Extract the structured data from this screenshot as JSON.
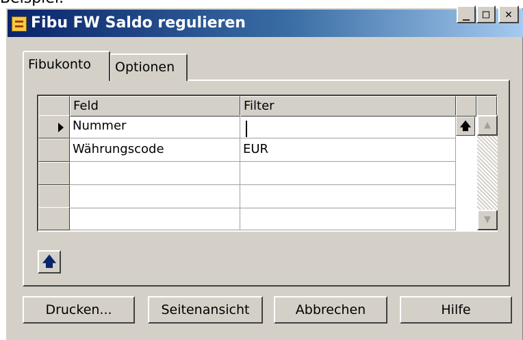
{
  "page_label": "Beispiel:",
  "window": {
    "title": "Fibu FW Saldo regulieren",
    "icon": "app-form-icon",
    "controls": {
      "minimize": "_",
      "maximize": "□",
      "close": "✕"
    }
  },
  "tabs": [
    {
      "label": "Fibukonto",
      "active": true
    },
    {
      "label": "Optionen",
      "active": false
    }
  ],
  "grid": {
    "columns": [
      "Feld",
      "Filter"
    ],
    "rows": [
      {
        "field": "Nummer",
        "filter": "",
        "current": true
      },
      {
        "field": "Währungscode",
        "filter": "EUR"
      },
      {
        "field": "",
        "filter": ""
      },
      {
        "field": "",
        "filter": ""
      },
      {
        "field": "",
        "filter": ""
      }
    ],
    "lookup_icon": "up-arrow-icon",
    "scroll_up": "▲",
    "scroll_down": "▼"
  },
  "nav_button_icon": "up-arrow-icon",
  "nav_button_glyph": "🡅",
  "buttons": {
    "print": "Drucken...",
    "preview": "Seitenansicht",
    "cancel": "Abbrechen",
    "help": "Hilfe"
  },
  "colors": {
    "face": "#d4d0c8",
    "title_start": "#0a246a",
    "title_end": "#a6caf0"
  }
}
